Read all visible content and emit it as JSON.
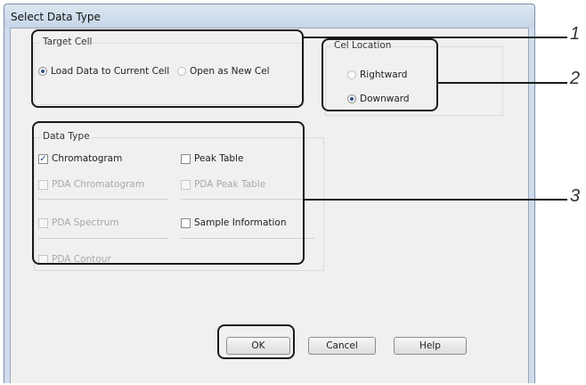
{
  "window": {
    "title": "Select Data Type"
  },
  "target_cell": {
    "title": "Target Cell",
    "options": [
      {
        "label": "Load Data to Current Cell",
        "selected": true
      },
      {
        "label": "Open as New Cel",
        "selected": false
      }
    ]
  },
  "cell_location": {
    "title": "Cel Location",
    "options": [
      {
        "label": "Rightward",
        "selected": false
      },
      {
        "label": "Downward",
        "selected": true
      }
    ]
  },
  "data_type": {
    "title": "Data Type",
    "items": [
      {
        "label": "Chromatogram",
        "checked": true,
        "enabled": true
      },
      {
        "label": "Peak Table",
        "checked": false,
        "enabled": true
      },
      {
        "label": "PDA Chromatogram",
        "checked": false,
        "enabled": false
      },
      {
        "label": "PDA Peak Table",
        "checked": false,
        "enabled": false
      },
      {
        "label": "PDA Spectrum",
        "checked": false,
        "enabled": false
      },
      {
        "label": "Sample Information",
        "checked": false,
        "enabled": true
      },
      {
        "label": "PDA Contour",
        "checked": false,
        "enabled": false
      }
    ]
  },
  "buttons": {
    "ok": "OK",
    "cancel": "Cancel",
    "help": "Help"
  },
  "callouts": [
    "1",
    "2",
    "3"
  ],
  "colors": {
    "titlebar": "#cfdcec",
    "dialog_bg": "#f0f0f0",
    "callout": "#1a1a1a"
  }
}
